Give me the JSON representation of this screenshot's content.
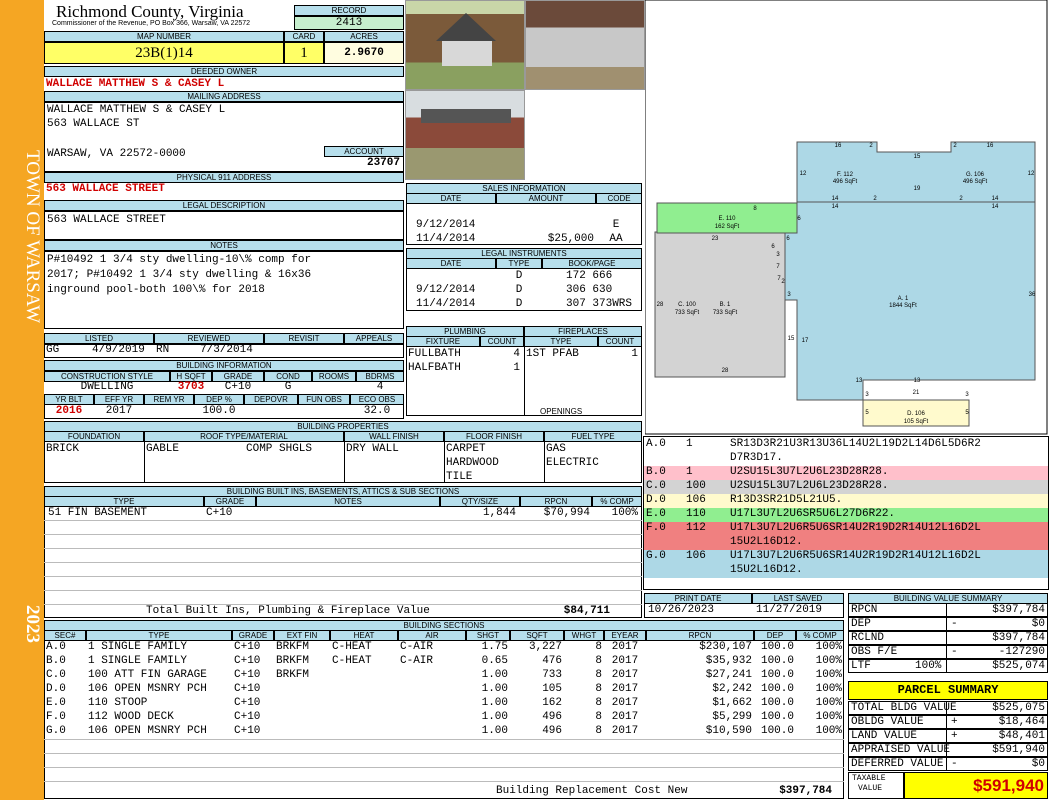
{
  "sidebar": {
    "town": "TOWN OF WARSAW",
    "year": "2023"
  },
  "header": {
    "county": "Richmond County, Virginia",
    "commissioner": "Commissioner of the Revenue, PO Box 366, Warsaw, VA 22572",
    "record_label": "RECORD",
    "record": "2413",
    "map_label": "MAP NUMBER",
    "map": "23B(1)14",
    "card_label": "CARD",
    "card": "1",
    "acres_label": "ACRES",
    "acres": "2.9670"
  },
  "owner": {
    "label": "DEEDED OWNER",
    "name": "WALLACE MATTHEW S & CASEY L"
  },
  "mailing": {
    "label": "MAILING ADDRESS",
    "line1": "WALLACE MATTHEW S & CASEY L",
    "line2": "563 WALLACE ST",
    "line3": "WARSAW, VA 22572-0000",
    "account_label": "ACCOUNT",
    "account": "23707"
  },
  "physical": {
    "label": "PHYSICAL 911 ADDRESS",
    "address": "563 WALLACE STREET"
  },
  "legal": {
    "label": "LEGAL DESCRIPTION",
    "text": "563 WALLACE STREET"
  },
  "notes": {
    "label": "NOTES",
    "l1": "P#10492 1 3/4 sty dwelling-10\\% comp for",
    "l2": "2017; P#10492 1 3/4 sty dwelling & 16x36",
    "l3": "inground pool-both 100\\% for 2018"
  },
  "review": {
    "listed_label": "LISTED",
    "reviewed_label": "REVIEWED",
    "revisit_label": "REVISIT",
    "appeals_label": "APPEALS",
    "listed_by": "GG",
    "listed_date": "4/9/2019",
    "reviewed_by": "RN",
    "reviewed_date": "7/3/2014"
  },
  "building_info": {
    "label": "BUILDING INFORMATION",
    "h_style": "CONSTRUCTION STYLE",
    "h_sqft": "H SQFT",
    "h_grade": "GRADE",
    "h_cond": "COND",
    "h_rooms": "ROOMS",
    "h_bdrms": "BDRMS",
    "style": "DWELLING",
    "sqft": "3703",
    "grade": "C+10",
    "cond": "G",
    "rooms": "",
    "bdrms": "4",
    "h_yrblt": "YR BLT",
    "h_effyr": "EFF YR",
    "h_remyr": "REM YR",
    "h_depp": "DEP %",
    "h_depovr": "DEPOVR",
    "h_funobs": "FUN OBS",
    "h_ecoobs": "ECO OBS",
    "yrblt": "2016",
    "effyr": "2017",
    "depp": "100.0",
    "ecoobs": "32.0"
  },
  "sales": {
    "label": "SALES INFORMATION",
    "h_date": "DATE",
    "h_amount": "AMOUNT",
    "h_code": "CODE",
    "rows": [
      {
        "date": "9/12/2014",
        "amount": "",
        "code": "E"
      },
      {
        "date": "11/4/2014",
        "amount": "$25,000",
        "code": "AA"
      }
    ]
  },
  "instruments": {
    "label": "LEGAL INSTRUMENTS",
    "h_date": "DATE",
    "h_type": "TYPE",
    "h_book": "BOOK/PAGE",
    "rows": [
      {
        "date": "",
        "type": "D",
        "book": "172 666"
      },
      {
        "date": "9/12/2014",
        "type": "D",
        "book": "306 630"
      },
      {
        "date": "11/4/2014",
        "type": "D",
        "book": "307 373WRS"
      }
    ]
  },
  "plumbing": {
    "label": "PLUMBING",
    "h_fixture": "FIXTURE",
    "h_count": "COUNT",
    "r1": "FULLBATH",
    "c1": "4",
    "r2": "HALFBATH",
    "c2": "1"
  },
  "fireplaces": {
    "label": "FIREPLACES",
    "h_type": "TYPE",
    "h_count": "COUNT",
    "r1": "1ST PFAB",
    "c1": "1",
    "openings": "OPENINGS"
  },
  "properties": {
    "label": "BUILDING PROPERTIES",
    "h_found": "FOUNDATION",
    "h_roof": "ROOF TYPE/MATERIAL",
    "h_wall": "WALL FINISH",
    "h_floor": "FLOOR FINISH",
    "h_fuel": "FUEL TYPE",
    "found": "BRICK",
    "roof1": "GABLE",
    "roof2": "COMP SHGLS",
    "wall": "DRY WALL",
    "floor1": "CARPET",
    "floor2": "HARDWOOD",
    "floor3": "TILE",
    "fuel1": "GAS",
    "fuel2": "ELECTRIC"
  },
  "builtins": {
    "label": "BUILDING BUILT INS, BASEMENTS, ATTICS & SUB SECTIONS",
    "h_type": "TYPE",
    "h_grade": "GRADE",
    "h_notes": "NOTES",
    "h_qty": "QTY/SIZE",
    "h_rpcn": "RPCN",
    "h_comp": "% COMP",
    "type": "51 FIN BASEMENT",
    "grade": "C+10",
    "qty": "1,844",
    "rpcn": "$70,994",
    "comp": "100%",
    "total_label": "Total Built Ins, Plumbing & Fireplace Value",
    "total": "$84,711"
  },
  "sections": {
    "label": "BUILDING SECTIONS",
    "headers": [
      "SEC#",
      "TYPE",
      "GRADE",
      "EXT FIN",
      "HEAT",
      "AIR",
      "SHGT",
      "SQFT",
      "WHGT",
      "EYEAR",
      "RPCN",
      "DEP",
      "% COMP"
    ],
    "rows": [
      [
        "A.0",
        "1 SINGLE FAMILY",
        "C+10",
        "BRKFM",
        "C-HEAT",
        "C-AIR",
        "1.75",
        "3,227",
        "8",
        "2017",
        "$230,107",
        "100.0",
        "100%"
      ],
      [
        "B.0",
        "1 SINGLE FAMILY",
        "C+10",
        "BRKFM",
        "C-HEAT",
        "C-AIR",
        "0.65",
        "476",
        "8",
        "2017",
        "$35,932",
        "100.0",
        "100%"
      ],
      [
        "C.0",
        "100 ATT FIN GARAGE",
        "C+10",
        "BRKFM",
        "",
        "",
        "1.00",
        "733",
        "8",
        "2017",
        "$27,241",
        "100.0",
        "100%"
      ],
      [
        "D.0",
        "106 OPEN MSNRY PCH",
        "C+10",
        "",
        "",
        "",
        "1.00",
        "105",
        "8",
        "2017",
        "$2,242",
        "100.0",
        "100%"
      ],
      [
        "E.0",
        "110 STOOP",
        "C+10",
        "",
        "",
        "",
        "1.00",
        "162",
        "8",
        "2017",
        "$1,662",
        "100.0",
        "100%"
      ],
      [
        "F.0",
        "112 WOOD DECK",
        "C+10",
        "",
        "",
        "",
        "1.00",
        "496",
        "8",
        "2017",
        "$5,299",
        "100.0",
        "100%"
      ],
      [
        "G.0",
        "106 OPEN MSNRY PCH",
        "C+10",
        "",
        "",
        "",
        "1.00",
        "496",
        "8",
        "2017",
        "$10,590",
        "100.0",
        "100%"
      ]
    ],
    "brcn_label": "Building Replacement Cost New",
    "brcn": "$397,784"
  },
  "sketch": {
    "f_name": "F. 112",
    "f_area": "496 SqFt",
    "g_name": "G. 106",
    "g_area": "496 SqFt",
    "e_name": "E. 110",
    "e_area": "162 SqFt",
    "c_name": "C. 100",
    "c_area": "733 SqFt",
    "b_name": "B. 1",
    "b_area": "733 SqFt",
    "a_name": "A. 1",
    "a_area": "1844 SqFt",
    "d_name": "D. 106",
    "d_area": "105 SqFt",
    "dims": [
      "16",
      "2",
      "15",
      "2",
      "16",
      "12",
      "12",
      "19",
      "14",
      "2",
      "2",
      "14",
      "14",
      "14",
      "8",
      "6",
      "23",
      "6",
      "6",
      "3",
      "7",
      "2",
      "7",
      "3",
      "28",
      "36",
      "17",
      "15",
      "13",
      "3",
      "21",
      "3",
      "13",
      "28",
      "5",
      "5"
    ],
    "colors": {
      "a": "#add8e6",
      "b": "#ffc0cb",
      "c": "#d3d3d3",
      "d": "#fffacd",
      "e": "#90ee90",
      "f": "#add8e6",
      "g": "#add8e6"
    }
  },
  "codes": [
    {
      "sec": "A.0",
      "n": "1",
      "code": "SR13D3R21U3R13U36L14U2L19D2L14D6L5D6R2",
      "code2": "D7R3D17.",
      "color": "#add8e6"
    },
    {
      "sec": "B.0",
      "n": "1",
      "code": "U2SU15L3U7L2U6L23D28R28.",
      "code2": "",
      "color": "#ffc0cb"
    },
    {
      "sec": "C.0",
      "n": "100",
      "code": "U2SU15L3U7L2U6L23D28R28.",
      "code2": "",
      "color": "#d3d3d3"
    },
    {
      "sec": "D.0",
      "n": "106",
      "code": "R13D3SR21D5L21U5.",
      "code2": "",
      "color": "#fffacd"
    },
    {
      "sec": "E.0",
      "n": "110",
      "code": "U17L3U7L2U6SR5U6L27D6R22.",
      "code2": "",
      "color": "#90ee90"
    },
    {
      "sec": "F.0",
      "n": "112",
      "code": "U17L3U7L2U6R5U6SR14U2R19D2R14U12L16D2L",
      "code2": "15U2L16D12.",
      "color": "#f08080"
    },
    {
      "sec": "G.0",
      "n": "106",
      "code": "U17L3U7L2U6R5U6SR14U2R19D2R14U12L16D2L",
      "code2": "15U2L16D12.",
      "color": "#add8e6"
    }
  ],
  "dates": {
    "print_label": "PRINT DATE",
    "print": "10/26/2023",
    "saved_label": "LAST SAVED",
    "saved": "11/27/2019"
  },
  "bvs": {
    "label": "BUILDING VALUE SUMMARY",
    "rpcn_l": "RPCN",
    "rpcn": "$397,784",
    "dep_l": "DEP",
    "dep_s": "-",
    "dep": "$0",
    "rclnd_l": "RCLND",
    "rclnd": "$397,784",
    "obs_l": "OBS F/E",
    "obs_s": "-",
    "obs": "-127290",
    "ltr_l": "LTF",
    "ltr_p": "100%",
    "ltr": "$525,074"
  },
  "parcel": {
    "label": "PARCEL SUMMARY",
    "tbv_l": "TOTAL BLDG VALUE",
    "tbv": "$525,075",
    "obldg_l": "OBLDG VALUE",
    "obldg_s": "+",
    "obldg": "$18,464",
    "land_l": "LAND VALUE",
    "land_s": "+",
    "land": "$48,401",
    "appr_l": "APPRAISED VALUE",
    "appr": "$591,940",
    "def_l": "DEFERRED VALUE",
    "def_s": "-",
    "def": "$0",
    "taxable_l1": "TAXABLE",
    "taxable_l2": "VALUE",
    "taxable": "$591,940"
  }
}
